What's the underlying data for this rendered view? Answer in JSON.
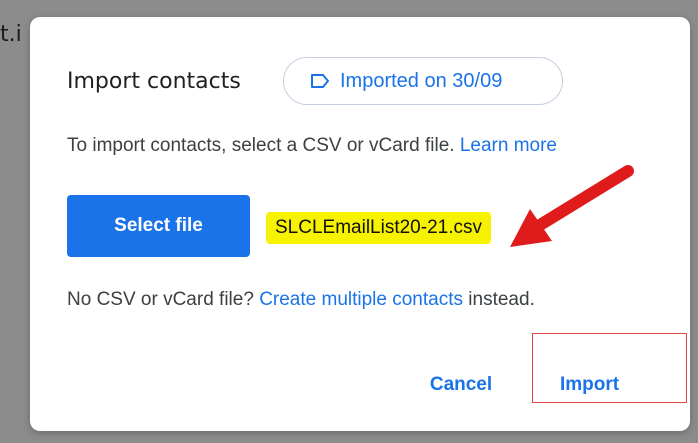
{
  "background": {
    "partial_text": "t.i"
  },
  "dialog": {
    "title": "Import contacts",
    "chip": {
      "label": "Imported on 30/09",
      "icon": "label-tag-icon"
    },
    "instruction": {
      "text": "To import contacts, select a CSV or vCard file.",
      "link": "Learn more"
    },
    "select_file_label": "Select file",
    "selected_file": "SLCLEmailList20-21.csv",
    "alternative": {
      "prefix": "No CSV or vCard file?",
      "link": "Create multiple contacts",
      "suffix": "instead."
    },
    "actions": {
      "cancel": "Cancel",
      "import": "Import"
    }
  },
  "annotations": {
    "arrow_color": "#e01b1b",
    "highlight_color": "#f7f200",
    "box_color": "#e04848"
  },
  "colors": {
    "accent": "#1a73e8",
    "text": "#3c4043",
    "title": "#202124"
  }
}
